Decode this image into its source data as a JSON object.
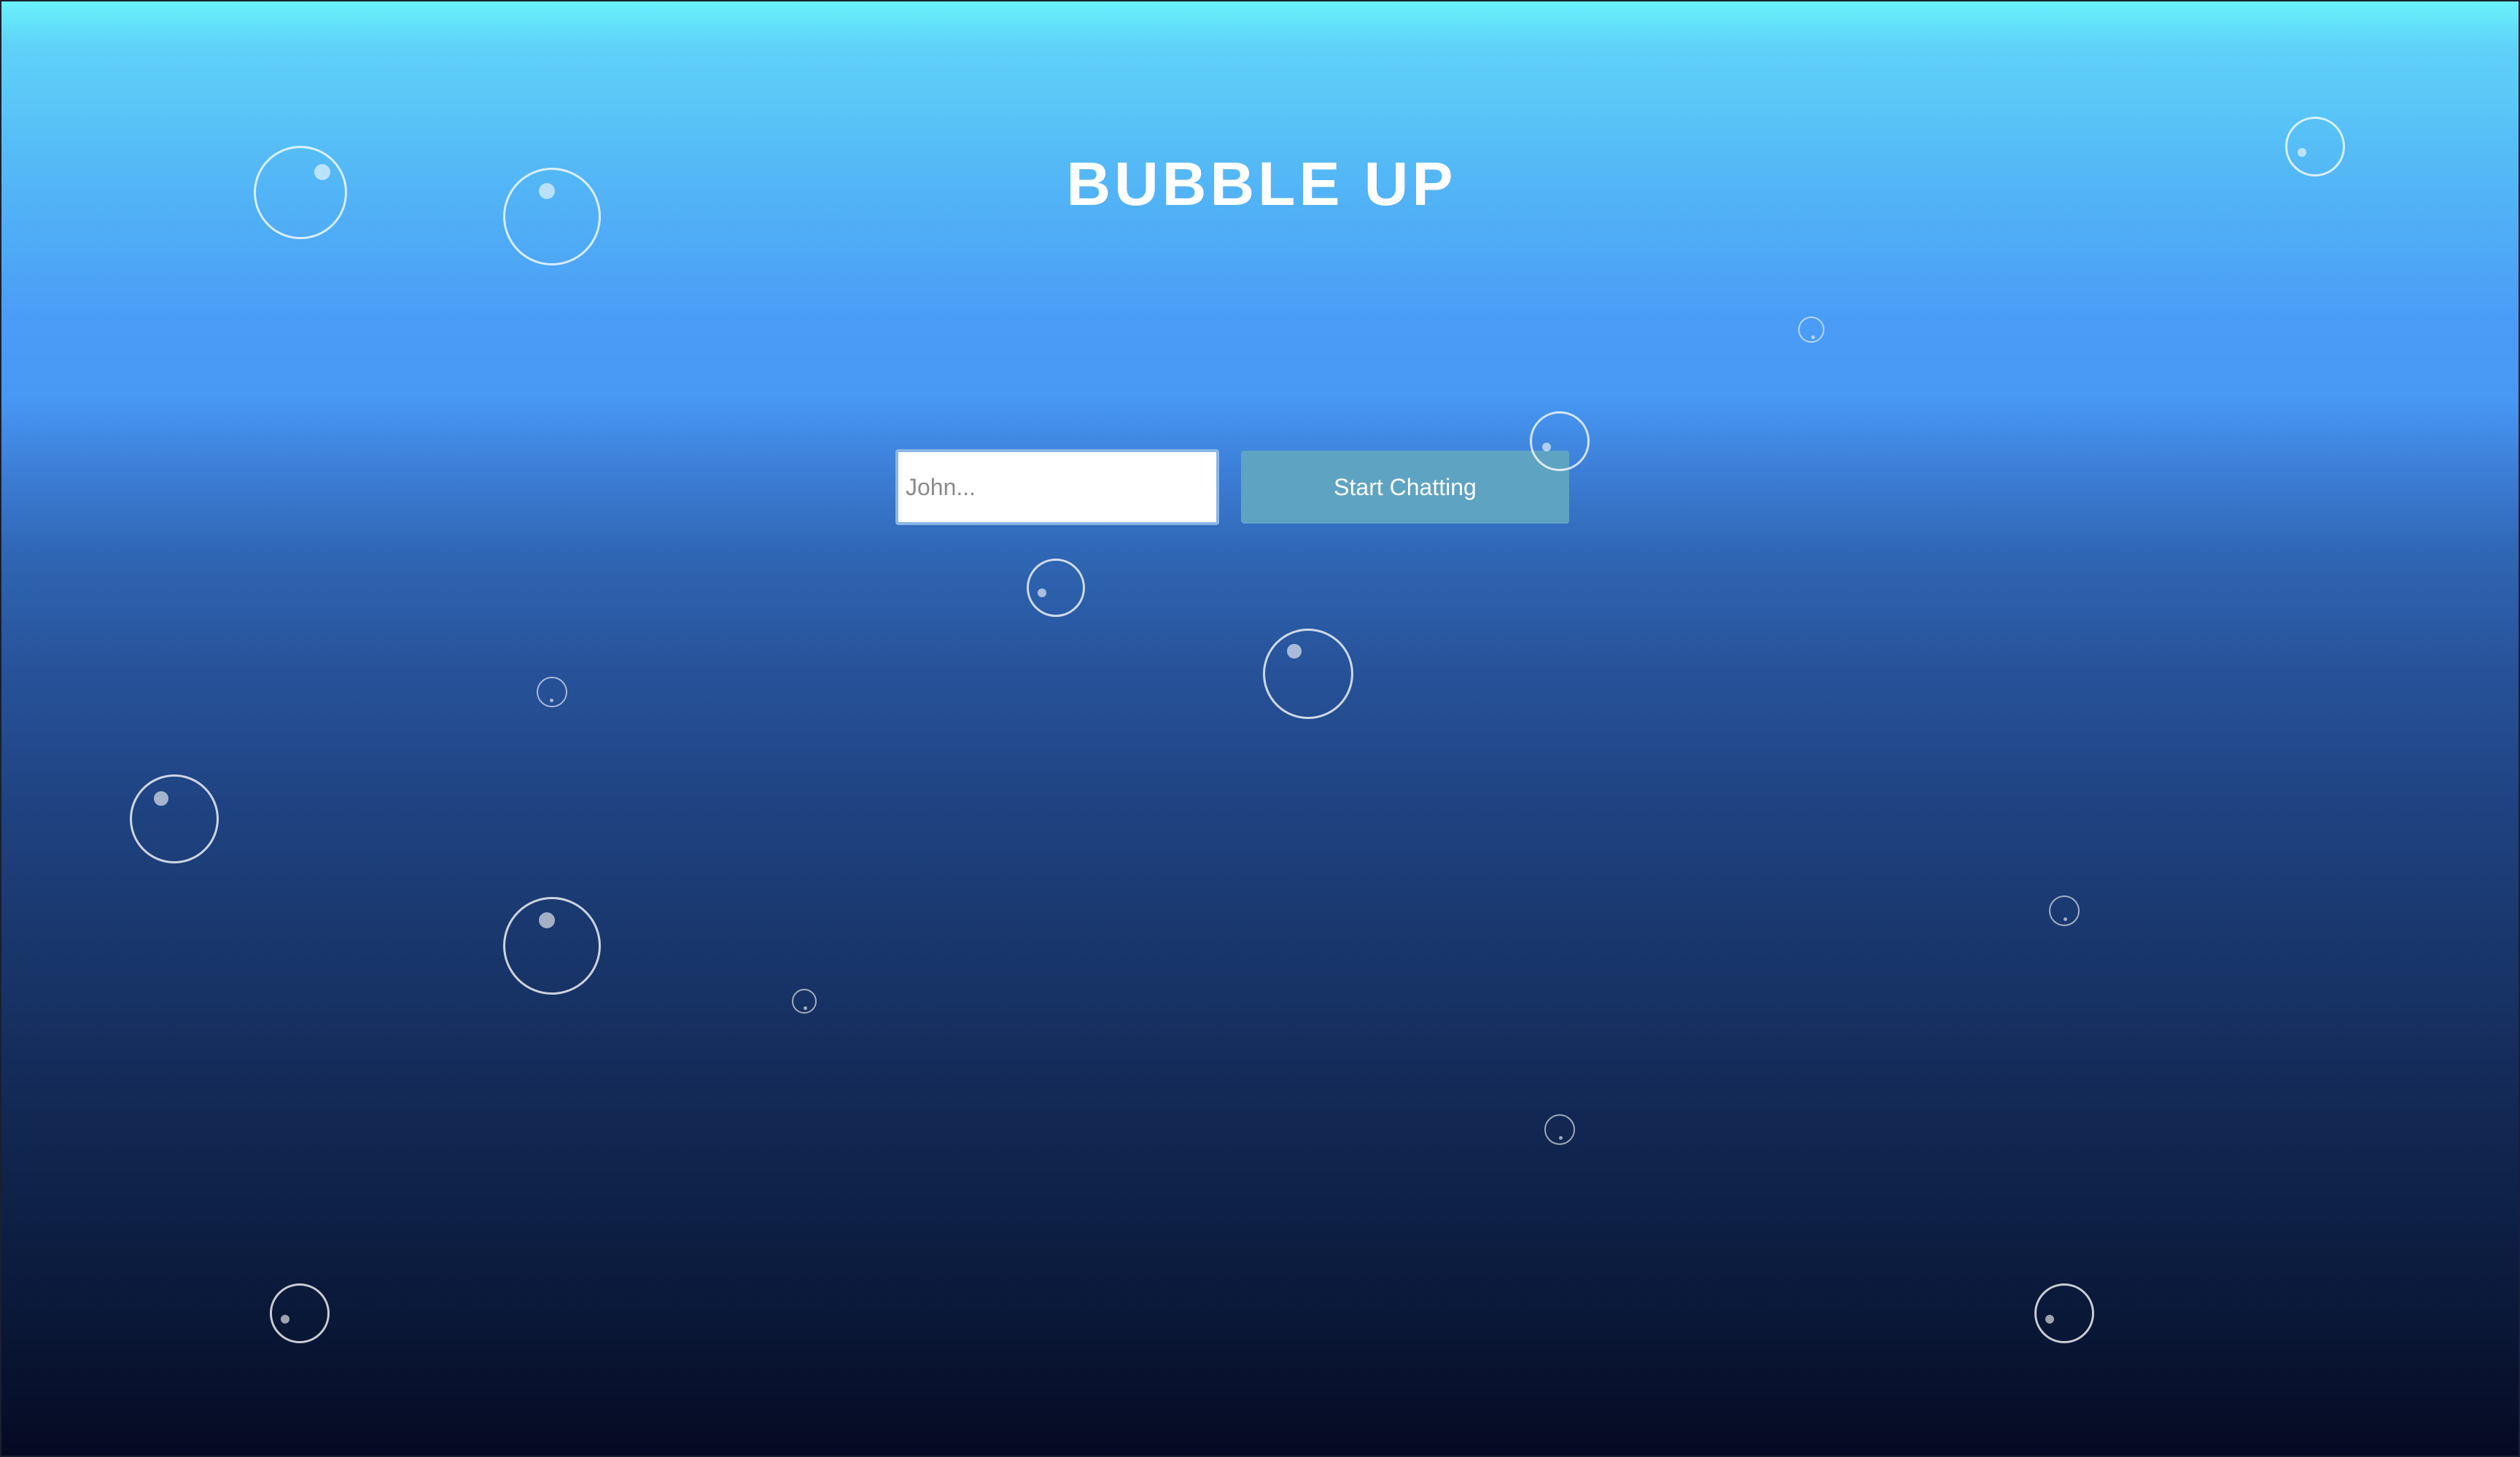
{
  "app": {
    "title": "BUBBLE UP"
  },
  "form": {
    "name_placeholder": "John...",
    "name_value": "",
    "start_label": "Start Chatting"
  },
  "colors": {
    "gradient_top": "#69f2fc",
    "gradient_mid": "#4799f4",
    "gradient_bottom": "#050a22",
    "button_bg": "#5fa3c2",
    "title": "#ffffff"
  },
  "decorations": {
    "bubble_icon": "bubble-icon"
  }
}
